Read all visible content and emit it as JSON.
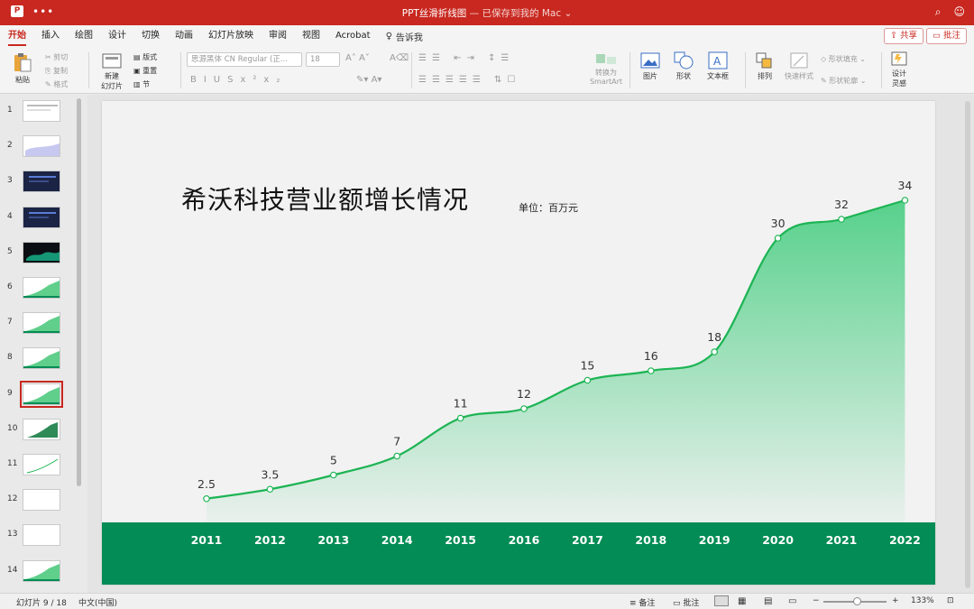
{
  "window": {
    "title": "PPT丝滑折线图",
    "subtitle": " — 已保存到我的 Mac",
    "chevron": "⌄"
  },
  "tabs": [
    "开始",
    "插入",
    "绘图",
    "设计",
    "切换",
    "动画",
    "幻灯片放映",
    "审阅",
    "视图",
    "Acrobat"
  ],
  "tell_me": "告诉我",
  "share_label": "共享",
  "comment_label": "批注",
  "ribbon": {
    "paste": "粘贴",
    "cut": "剪切",
    "copy": "复制",
    "format": "格式",
    "new_slide": "新建",
    "new_slide2": "幻灯片",
    "layout": "版式",
    "reset": "重置",
    "section": "节",
    "font_name": "思源黑体 CN Regular (正...",
    "font_size": "18",
    "convert_smartart": "转换为",
    "convert_smartart2": "SmartArt",
    "picture": "图片",
    "shape": "形状",
    "textbox": "文本框",
    "arrange": "排列",
    "quick_styles": "快速样式",
    "shape_fill": "形状填充",
    "shape_outline": "形状轮廓",
    "design_ideas": "设计",
    "design_ideas2": "灵感"
  },
  "slides": [
    {
      "num": "1"
    },
    {
      "num": "2"
    },
    {
      "num": "3"
    },
    {
      "num": "4"
    },
    {
      "num": "5"
    },
    {
      "num": "6"
    },
    {
      "num": "7"
    },
    {
      "num": "8"
    },
    {
      "num": "9"
    },
    {
      "num": "10"
    },
    {
      "num": "11"
    },
    {
      "num": "12"
    },
    {
      "num": "13"
    },
    {
      "num": "14"
    }
  ],
  "selected_slide": 9,
  "slide_content": {
    "title": "希沃科技营业额增长情况",
    "unit": "单位：百万元"
  },
  "chart_data": {
    "type": "area",
    "categories": [
      "2011",
      "2012",
      "2013",
      "2014",
      "2015",
      "2016",
      "2017",
      "2018",
      "2019",
      "2020",
      "2021",
      "2022"
    ],
    "values": [
      2.5,
      3.5,
      5,
      7,
      11,
      12,
      15,
      16,
      18,
      30,
      32,
      34
    ],
    "data_labels": [
      "2.5",
      "3.5",
      "5",
      "7",
      "11",
      "12",
      "15",
      "16",
      "18",
      "30",
      "32",
      "34"
    ],
    "ylim": [
      0,
      34
    ],
    "line_color": "#1db454",
    "fill_top": "#4fcf86",
    "band_color": "#038c55",
    "grid": false
  },
  "status": {
    "slide_pos": "幻灯片 9 / 18",
    "language": "中文(中国)",
    "notes": "备注",
    "comments": "批注",
    "zoom": "133%",
    "minus": "−",
    "plus": "+"
  },
  "colors": {
    "accent": "#c8281f"
  }
}
